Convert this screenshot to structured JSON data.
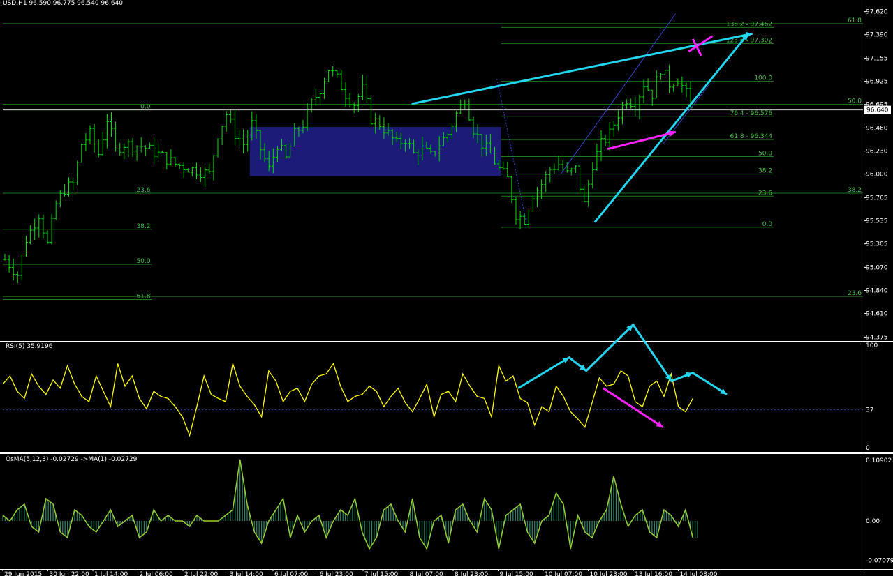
{
  "colors": {
    "background": "#000000",
    "grid_line": "#ffffff",
    "candle": "#00e000",
    "fib": "#1f7a1f",
    "fib_text": "#4cbf4c",
    "zone": "#1c1c78",
    "trend_cyan": "#22d6f0",
    "annotation_magenta": "#ff22ff",
    "channel": "#3344cc",
    "rsi_line": "#ffff00",
    "osma_line": "#9acd32",
    "osma_hist": "#2f8a6a",
    "axis_text": "#ffffff",
    "price_tag_bg": "#ffffff",
    "price_tag_text": "#000000"
  },
  "header": {
    "main": "USD,H1  96.590 96.775 96.540 96.640",
    "rsi": "RSI(5) 35.9196",
    "osma": "OsMA(5,12,3) -0.02729  ->MA(1) -0.02729"
  },
  "current_price": "96.640",
  "chart_data": [
    {
      "name": "price",
      "type": "candlestick",
      "yticks": [
        "97.620",
        "97.390",
        "97.155",
        "96.925",
        "96.695",
        "96.460",
        "96.230",
        "96.000",
        "95.765",
        "95.535",
        "95.305",
        "95.070",
        "94.840",
        "94.610",
        "94.375"
      ],
      "ylim": [
        94.35,
        97.68
      ],
      "path": [
        [
          0,
          95.15
        ],
        [
          3,
          95.0
        ],
        [
          5,
          95.35
        ],
        [
          8,
          95.6
        ],
        [
          10,
          95.3
        ],
        [
          12,
          95.7
        ],
        [
          14,
          95.85
        ],
        [
          16,
          95.9
        ],
        [
          18,
          96.3
        ],
        [
          20,
          96.4
        ],
        [
          22,
          96.2
        ],
        [
          24,
          96.55
        ],
        [
          26,
          96.25
        ],
        [
          28,
          96.3
        ],
        [
          32,
          96.28
        ],
        [
          36,
          96.2
        ],
        [
          40,
          96.1
        ],
        [
          44,
          96.05
        ],
        [
          48,
          96.0
        ],
        [
          50,
          96.4
        ],
        [
          52,
          96.6
        ],
        [
          54,
          96.4
        ],
        [
          56,
          96.3
        ],
        [
          58,
          96.5
        ],
        [
          60,
          96.25
        ],
        [
          62,
          96.05
        ],
        [
          64,
          96.3
        ],
        [
          66,
          96.15
        ],
        [
          68,
          96.4
        ],
        [
          70,
          96.5
        ],
        [
          72,
          96.7
        ],
        [
          74,
          96.85
        ],
        [
          76,
          97.05
        ],
        [
          78,
          96.95
        ],
        [
          80,
          96.8
        ],
        [
          82,
          96.7
        ],
        [
          84,
          96.85
        ],
        [
          86,
          96.55
        ],
        [
          88,
          96.5
        ],
        [
          90,
          96.4
        ],
        [
          92,
          96.3
        ],
        [
          94,
          96.35
        ],
        [
          96,
          96.2
        ],
        [
          98,
          96.25
        ],
        [
          100,
          96.18
        ],
        [
          102,
          96.3
        ],
        [
          104,
          96.4
        ],
        [
          106,
          96.6
        ],
        [
          108,
          96.75
        ],
        [
          110,
          96.45
        ],
        [
          112,
          96.3
        ],
        [
          114,
          96.2
        ],
        [
          116,
          96.05
        ],
        [
          118,
          95.95
        ],
        [
          120,
          95.6
        ],
        [
          122,
          95.55
        ],
        [
          124,
          95.8
        ],
        [
          126,
          95.9
        ],
        [
          128,
          96.05
        ],
        [
          130,
          96.1
        ],
        [
          132,
          96.0
        ],
        [
          134,
          96.05
        ],
        [
          136,
          95.7
        ],
        [
          138,
          96.1
        ],
        [
          140,
          96.3
        ],
        [
          142,
          96.4
        ],
        [
          144,
          96.6
        ],
        [
          146,
          96.75
        ],
        [
          148,
          96.7
        ],
        [
          150,
          96.9
        ],
        [
          152,
          96.8
        ],
        [
          154,
          97.05
        ],
        [
          156,
          96.9
        ],
        [
          158,
          96.95
        ],
        [
          160,
          96.8
        ],
        [
          161,
          96.64
        ]
      ],
      "bar_count": 162,
      "zone": {
        "bar_start": 58,
        "bar_end": 117,
        "price_high": 96.47,
        "price_low": 95.98
      },
      "fib_left": {
        "levels": [
          "0.0",
          "23.6",
          "38.2",
          "50.0",
          "61.8"
        ],
        "prices": [
          96.64,
          95.81,
          95.45,
          95.1,
          94.75
        ],
        "bar_start": 0,
        "bar_end": 35
      },
      "fib_right": {
        "labels": [
          "138.2 - 97.462",
          "123.6 - 97.302",
          "100.0",
          "76.4 - 96.576",
          "61.8 - 96.344",
          "50.0",
          "38.2",
          "23.6",
          "0.0"
        ],
        "prices": [
          97.462,
          97.302,
          96.925,
          96.576,
          96.344,
          96.175,
          96.0,
          95.78,
          95.47
        ],
        "bar_start": 117,
        "bar_end": 181
      },
      "fib_wide": {
        "labels": [
          "61.8",
          "50.0",
          "38.2",
          "23.6"
        ],
        "prices": [
          97.5,
          96.695,
          95.81,
          94.78
        ]
      },
      "annotations": {
        "upper_trend": {
          "from": [
            96,
            96.7
          ],
          "to": [
            176,
            97.4
          ]
        },
        "lower_trend": {
          "from": [
            139,
            95.52
          ],
          "to": [
            175,
            97.4
          ]
        },
        "magenta_price": {
          "from": [
            142,
            96.25
          ],
          "to": [
            158,
            96.42
          ]
        },
        "channel_upper": {
          "from": [
            131,
            96.0
          ],
          "to": [
            158,
            97.6
          ]
        },
        "channel_lower": {
          "from": [
            155,
            96.3
          ],
          "to": [
            166,
            96.9
          ]
        },
        "dotted_down": {
          "from": [
            116,
            96.95
          ],
          "to": [
            123,
            95.5
          ]
        },
        "x_mark": [
          163,
          97.25
        ]
      }
    },
    {
      "name": "rsi",
      "type": "line",
      "series_label": "RSI(5) 35.9196",
      "ylim": [
        0,
        100
      ],
      "yticks": [
        "100",
        "37",
        "0"
      ],
      "level": 37,
      "values_shape": [
        62,
        70,
        55,
        48,
        72,
        60,
        52,
        66,
        58,
        80,
        62,
        50,
        45,
        70,
        55,
        40,
        82,
        60,
        70,
        48,
        38,
        55,
        50,
        48,
        40,
        30,
        12,
        40,
        70,
        52,
        48,
        45,
        82,
        60,
        50,
        42,
        30,
        75,
        65,
        45,
        55,
        58,
        45,
        62,
        70,
        72,
        82,
        60,
        45,
        50,
        52,
        60,
        55,
        40,
        50,
        58,
        44,
        35,
        48,
        62,
        30,
        52,
        55,
        45,
        72,
        60,
        50,
        48,
        30,
        80,
        65,
        70,
        48,
        44,
        22,
        40,
        35,
        60,
        50,
        35,
        28,
        20,
        44,
        68,
        60,
        62,
        75,
        70,
        45,
        40,
        60,
        65,
        50,
        72,
        40,
        35,
        48
      ],
      "annotations": {
        "cyan_polyline": [
          [
            121,
            58
          ],
          [
            133,
            88
          ],
          [
            137,
            75
          ],
          [
            148,
            120
          ],
          [
            157,
            65
          ],
          [
            162,
            73
          ],
          [
            170,
            52
          ]
        ],
        "magenta": {
          "from": [
            141,
            58
          ],
          "to": [
            155,
            20
          ]
        }
      }
    },
    {
      "name": "osma",
      "type": "histogram",
      "series_label": "OsMA(5,12,3) -0.02729  ->MA(1) -0.02729",
      "ylim": [
        -0.085,
        0.12
      ],
      "yticks": [
        "0.10902",
        "0.00",
        "-0.07079"
      ],
      "zero": 0,
      "values_shape": [
        0.01,
        0.0,
        0.02,
        0.03,
        -0.01,
        -0.02,
        0.04,
        0.03,
        -0.02,
        -0.03,
        0.02,
        0.01,
        -0.01,
        -0.02,
        0.0,
        0.02,
        -0.01,
        0.0,
        0.01,
        -0.03,
        -0.02,
        0.02,
        0.0,
        0.01,
        0.0,
        0.0,
        -0.01,
        0.01,
        0.0,
        0.0,
        0.0,
        0.01,
        0.02,
        0.11,
        0.03,
        -0.02,
        -0.04,
        0.0,
        0.02,
        0.04,
        -0.03,
        0.01,
        -0.02,
        0.0,
        0.01,
        -0.03,
        0.0,
        0.02,
        0.01,
        0.04,
        -0.02,
        -0.05,
        -0.03,
        0.02,
        0.03,
        0.0,
        -0.02,
        0.04,
        -0.03,
        -0.05,
        0.0,
        0.01,
        -0.04,
        0.02,
        0.03,
        0.0,
        -0.02,
        0.04,
        0.02,
        -0.05,
        0.01,
        0.02,
        0.03,
        -0.02,
        -0.04,
        0.0,
        0.01,
        0.05,
        0.03,
        -0.05,
        0.01,
        -0.02,
        -0.03,
        0.0,
        0.02,
        0.08,
        0.03,
        -0.01,
        0.01,
        0.02,
        -0.02,
        -0.03,
        0.02,
        0.01,
        -0.01,
        0.02,
        -0.03
      ]
    }
  ],
  "x_axis": {
    "ticks": [
      "29 Jun 2015",
      "30 Jun 22:00",
      "1 Jul 14:00",
      "2 Jul 06:00",
      "2 Jul 22:00",
      "3 Jul 14:00",
      "6 Jul 07:00",
      "6 Jul 23:00",
      "7 Jul 15:00",
      "8 Jul 07:00",
      "8 Jul 23:00",
      "9 Jul 15:00",
      "10 Jul 07:00",
      "10 Jul 23:00",
      "13 Jul 16:00",
      "14 Jul 08:00"
    ]
  }
}
